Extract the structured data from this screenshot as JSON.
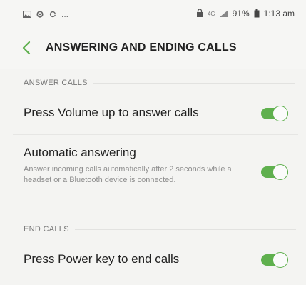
{
  "status_bar": {
    "overflow_indicator": "...",
    "network_label": "4G",
    "battery_percent": "91%",
    "time": "1:13 am"
  },
  "header": {
    "title": "ANSWERING AND ENDING CALLS",
    "back_icon": "chevron-left-icon"
  },
  "sections": [
    {
      "header": "ANSWER CALLS",
      "items": [
        {
          "title": "Press Volume up to answer calls",
          "enabled": true
        },
        {
          "title": "Automatic answering",
          "description": "Answer incoming calls automatically after 2 seconds while a headset or a Bluetooth device is connected.",
          "enabled": true
        }
      ]
    },
    {
      "header": "END CALLS",
      "items": [
        {
          "title": "Press Power key to end calls",
          "enabled": true
        }
      ]
    }
  ],
  "colors": {
    "accent": "#5fb04e",
    "background": "#f4f4f2"
  }
}
